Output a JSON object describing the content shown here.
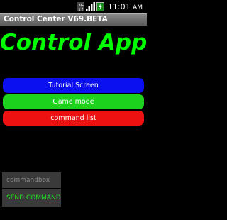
{
  "status_bar": {
    "time": "11:01",
    "time_suffix": "AM",
    "network_label": "3G",
    "icons": [
      "network-3g-icon",
      "signal-icon",
      "battery-icon"
    ]
  },
  "window": {
    "title": "Control Center V69.BETA"
  },
  "app": {
    "heading": "Control App"
  },
  "buttons": {
    "tutorial": "Tutorial Screen",
    "game": "Game mode",
    "command_list": "command list"
  },
  "command": {
    "placeholder": "commandbox",
    "value": "",
    "send_label": "SEND COMMAND"
  },
  "colors": {
    "background": "#000000",
    "heading": "#00ff00",
    "tutorial_button": "#0a10ee",
    "game_button": "#1cd21c",
    "command_list_button": "#ee1111",
    "send_text": "#22dd22"
  }
}
